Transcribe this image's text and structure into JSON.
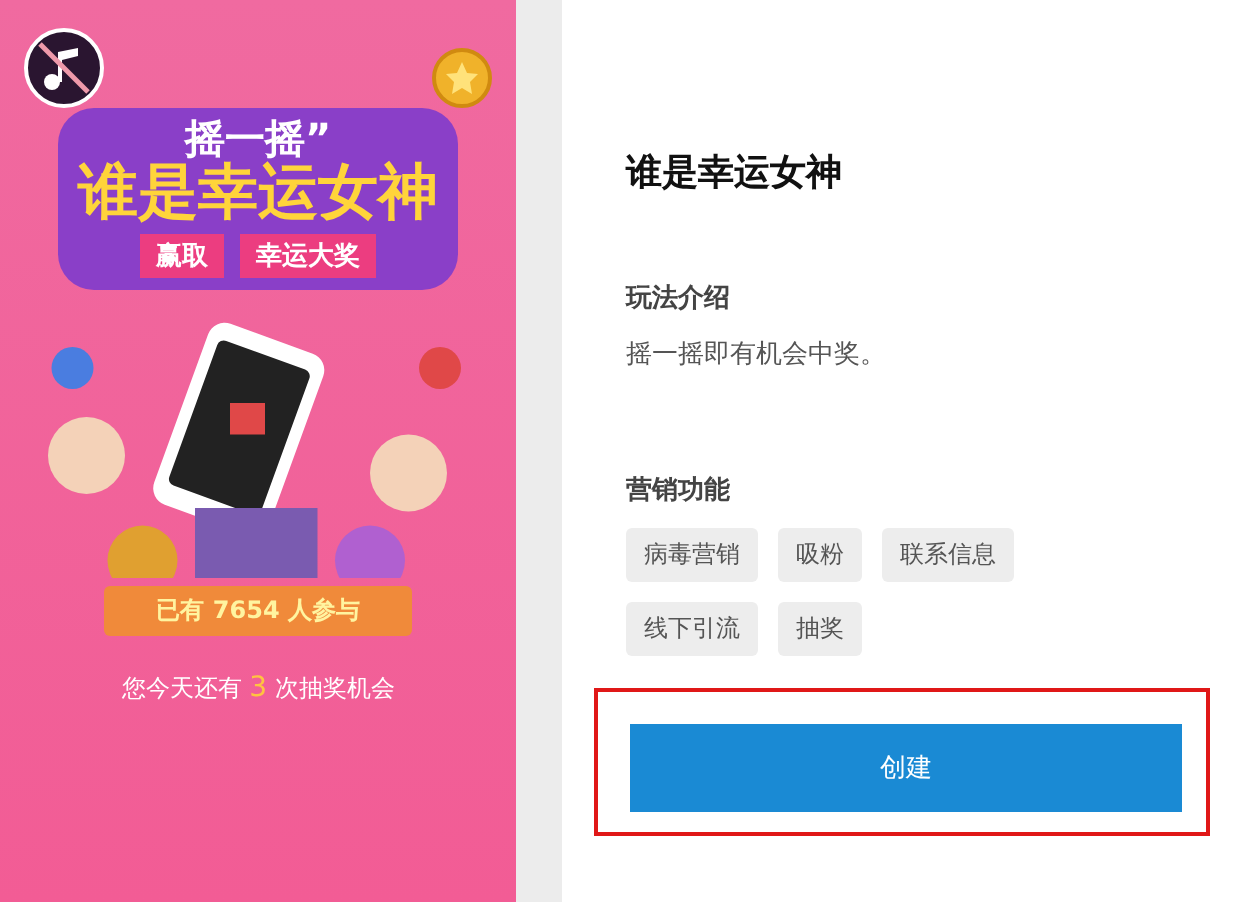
{
  "poster": {
    "kicker": "摇一摇”",
    "title": "谁是幸运女神",
    "banner": [
      "赢取",
      "幸运大奖"
    ],
    "participants": "已有 7654 人参与",
    "chances": {
      "before": "您今天还有",
      "count": "3",
      "after": "次抽奖机会"
    }
  },
  "detail": {
    "title": "谁是幸运女神",
    "intro": {
      "heading": "玩法介绍",
      "body": "摇一摇即有机会中奖。"
    },
    "marketing": {
      "heading": "营销功能",
      "tags": [
        "病毒营销",
        "吸粉",
        "联系信息",
        "线下引流",
        "抽奖"
      ]
    },
    "create_button": {
      "label": "创建",
      "highlighted": true
    }
  }
}
